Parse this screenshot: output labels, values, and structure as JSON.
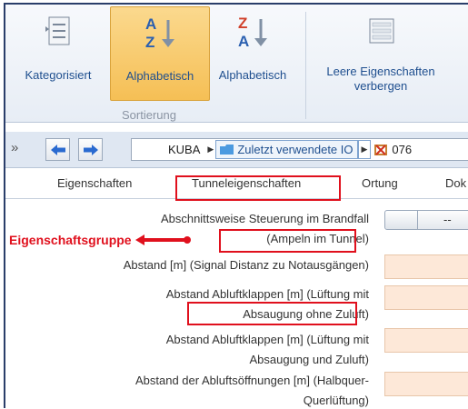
{
  "ribbon": {
    "buttons": [
      {
        "label": "Kategorisiert",
        "icon": "categorized-list-icon"
      },
      {
        "label": "Alphabetisch",
        "icon": "sort-az-icon",
        "active": true
      },
      {
        "label": "Alphabetisch",
        "icon": "sort-za-icon"
      },
      {
        "label_line1": "Leere Eigenschaften",
        "label_line2": "verbergen",
        "icon": "hide-empty-properties-icon"
      }
    ],
    "group_label": "Sortierung"
  },
  "toolbar": {
    "chevron": "»",
    "back_icon": "arrow-left-icon",
    "forward_icon": "arrow-right-icon",
    "breadcrumb": {
      "root": "KUBA",
      "folder": "Zuletzt verwendete IO",
      "item": "076"
    }
  },
  "tabs": [
    "Eigenschaften",
    "Tunneleigenschaften",
    "Ortung",
    "Dok"
  ],
  "annotation": {
    "label": "Eigenschaftsgruppe",
    "color": "#e0101d"
  },
  "properties": [
    {
      "line1": "Abschnittsweise Steuerung im Brandfall",
      "line2": "(Ampeln im Tunnel)",
      "value": "--"
    },
    {
      "line1": "Abstand [m] (Signal Distanz zu Notausgängen)",
      "line2": ""
    },
    {
      "line1": "Abstand Abluftklappen [m] (Lüftung mit",
      "line2": "Absaugung ohne Zuluft)"
    },
    {
      "line1": "Abstand Abluftklappen [m] (Lüftung mit",
      "line2": "Absaugung und Zuluft)"
    },
    {
      "line1": "Abstand der Abluftsöffnungen [m] (Halbquer-",
      "line2": "Querlüftung)"
    }
  ],
  "colors": {
    "accent": "#f5bf55",
    "highlight": "#e0101d",
    "value_bg": "#fde8d8"
  }
}
